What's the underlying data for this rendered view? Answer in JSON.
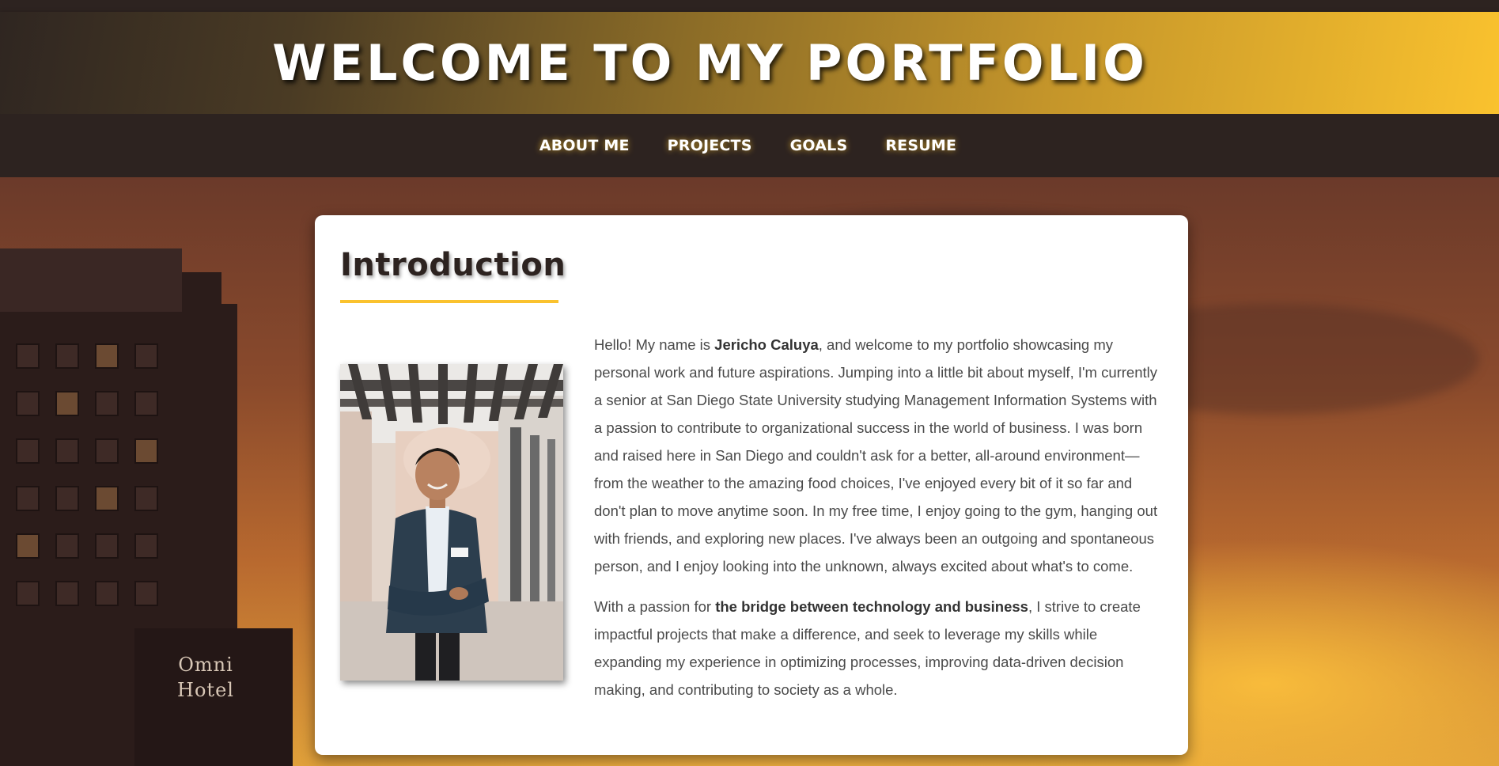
{
  "header": {
    "title": "WELCOME TO MY PORTFOLIO"
  },
  "nav": {
    "items": [
      {
        "label": "ABOUT ME"
      },
      {
        "label": "PROJECTS"
      },
      {
        "label": "GOALS"
      },
      {
        "label": "RESUME"
      }
    ]
  },
  "intro": {
    "heading": "Introduction",
    "p1_before": "Hello! My name is ",
    "p1_name": "Jericho Caluya",
    "p1_after": ", and welcome to my portfolio showcasing my personal work and future aspirations. Jumping into a little bit about myself, I'm currently a senior at San Diego State University studying Management Information Systems with a passion to contribute to organizational success in the world of business. I was born and raised here in San Diego and couldn't ask for a better, all-around environment—from the weather to the amazing food choices, I've enjoyed every bit of it so far and don't plan to move anytime soon. In my free time, I enjoy going to the gym, hanging out with friends, and exploring new places. I've always been an outgoing and spontaneous person, and I enjoy looking into the unknown, always excited about what's to come.",
    "p2_before": "With a passion for ",
    "p2_bold": "the bridge between technology and business",
    "p2_after": ", I strive to create impactful projects that make a difference, and seek to leverage my skills while expanding my experience in optimizing processes, improving data-driven decision making, and contributing to society as a whole."
  },
  "background": {
    "sign_line1": "Omni",
    "sign_line2": "Hotel"
  },
  "colors": {
    "header_dark": "#2d2320",
    "accent": "#fac22e",
    "card_bg": "#ffffff",
    "body_text": "#4a4a4a"
  }
}
